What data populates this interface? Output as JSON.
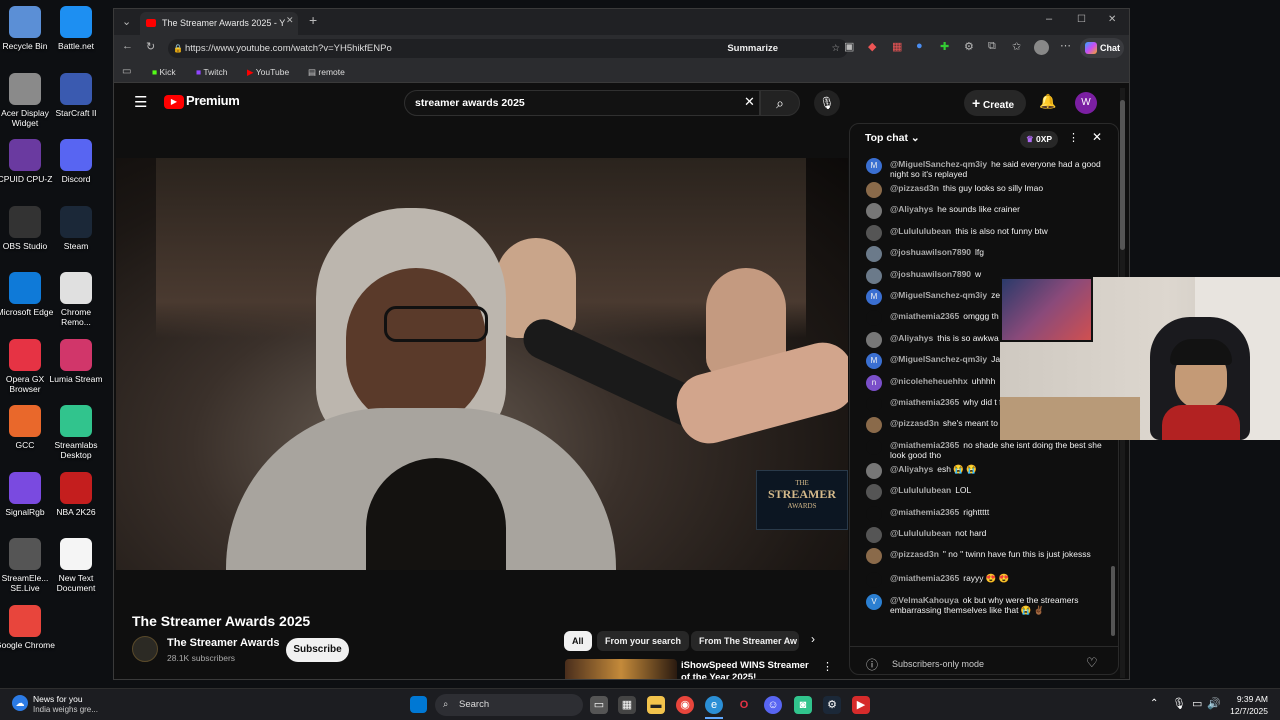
{
  "desktop": {
    "icons": [
      {
        "label": "Recycle Bin",
        "icon": "recycle-bin-icon"
      },
      {
        "label": "Battle.net",
        "icon": "battlenet-icon"
      },
      {
        "label": "Acer Display Widget",
        "icon": "display-widget-icon"
      },
      {
        "label": "StarCraft II",
        "icon": "starcraft-icon"
      },
      {
        "label": "CPUID CPU-Z",
        "icon": "cpuz-icon"
      },
      {
        "label": "Discord",
        "icon": "discord-icon"
      },
      {
        "label": "OBS Studio",
        "icon": "obs-icon"
      },
      {
        "label": "Steam",
        "icon": "steam-icon"
      },
      {
        "label": "Microsoft Edge",
        "icon": "edge-icon"
      },
      {
        "label": "Chrome Remo...",
        "icon": "chrome-remote-icon"
      },
      {
        "label": "Opera GX Browser",
        "icon": "opera-icon"
      },
      {
        "label": "Lumia Stream",
        "icon": "lumia-icon"
      },
      {
        "label": "GCC",
        "icon": "gcc-icon"
      },
      {
        "label": "Streamlabs Desktop",
        "icon": "streamlabs-icon"
      },
      {
        "label": "SignalRgb",
        "icon": "signalrgb-icon"
      },
      {
        "label": "NBA 2K26",
        "icon": "nba-icon"
      },
      {
        "label": "StreamEle... SE.Live",
        "icon": "streamelements-icon"
      },
      {
        "label": "New Text Document",
        "icon": "text-document-icon"
      },
      {
        "label": "Google Chrome",
        "icon": "chrome-icon"
      }
    ]
  },
  "browser": {
    "tab_title": "The Streamer Awards 2025 - Y",
    "url": "https://www.youtube.com/watch?v=YH5hikfENPo",
    "summarize": "Summarize",
    "chat_label": "Chat",
    "favorites": [
      "Kick",
      "Twitch",
      "YouTube",
      "remote"
    ]
  },
  "youtube": {
    "brand": "Premium",
    "search_value": "streamer awards 2025",
    "create": "Create",
    "avatar": "W",
    "video_title": "The Streamer Awards 2025",
    "channel": "The Streamer Awards",
    "subscribers": "28.1K subscribers",
    "subscribe": "Subscribe",
    "overlay_line1": "THE",
    "overlay_line2": "STREAMER",
    "overlay_line3": "AWARDS",
    "chips": [
      "All",
      "From your search",
      "From The Streamer Aw"
    ],
    "rec_title": "iShowSpeed WINS Streamer of the Year 2025!"
  },
  "chat": {
    "header": "Top chat",
    "points": "0XP",
    "footer": "Subscribers-only mode",
    "messages": [
      {
        "user": "@MiguelSanchez-qm3iy",
        "text": "he said everyone had a good night so it's replayed",
        "av": "M",
        "color": "#3a6fd1"
      },
      {
        "user": "@pizzasd3n",
        "text": "this guy looks so silly lmao",
        "av": "",
        "color": "#8a6a4a"
      },
      {
        "user": "@Aliyahys",
        "text": "he sounds like crainer",
        "av": "",
        "color": "#777"
      },
      {
        "user": "@Lulululubean",
        "text": "this is also not funny btw",
        "av": "",
        "color": "#555"
      },
      {
        "user": "@joshuawilson7890",
        "text": "lfg",
        "av": "",
        "color": "#6b7a8a"
      },
      {
        "user": "@joshuawilson7890",
        "text": "w",
        "av": "",
        "color": "#6b7a8a"
      },
      {
        "user": "@MiguelSanchez-qm3iy",
        "text": "ze",
        "av": "M",
        "color": "#3a6fd1"
      },
      {
        "user": "@miathemia2365",
        "text": "omggg th cringeeeee",
        "av": "",
        "color": "#0f0f0f"
      },
      {
        "user": "@Aliyahys",
        "text": "this is so awkwa",
        "av": "",
        "color": "#777"
      },
      {
        "user": "@MiguelSanchez-qm3iy",
        "text": "Ja",
        "av": "M",
        "color": "#3a6fd1"
      },
      {
        "user": "@nicoleheheuehhx",
        "text": "uhhhh",
        "av": "n",
        "color": "#7a4fc9"
      },
      {
        "user": "@miathemia2365",
        "text": "why did t for this likeeeee",
        "av": "",
        "color": "#0f0f0f"
      },
      {
        "user": "@pizzasd3n",
        "text": "she's meant to gggguysssssssss",
        "av": "",
        "color": "#8a6a4a"
      },
      {
        "user": "@miathemia2365",
        "text": "no shade she isnt doing the best she look good tho",
        "av": "",
        "color": "#0f0f0f"
      },
      {
        "user": "@Aliyahys",
        "text": "esh 😭 😭",
        "av": "",
        "color": "#777"
      },
      {
        "user": "@Lulululubean",
        "text": "LOL",
        "av": "",
        "color": "#555"
      },
      {
        "user": "@miathemia2365",
        "text": "righttttt",
        "av": "",
        "color": "#0f0f0f"
      },
      {
        "user": "@Lulululubean",
        "text": "not hard",
        "av": "",
        "color": "#555"
      },
      {
        "user": "@pizzasd3n",
        "text": "\" no \" twinn have fun this is just jokesss",
        "av": "",
        "color": "#8a6a4a"
      },
      {
        "user": "@miathemia2365",
        "text": "rayyy 😍 😍",
        "av": "",
        "color": "#0f0f0f"
      },
      {
        "user": "@VelmaKahouya",
        "text": "ok but why were the streamers embarrassing themselves like that 😭 ✌🏾",
        "av": "V",
        "color": "#2b7fd1"
      }
    ]
  },
  "taskbar": {
    "news_title": "News for you",
    "news_sub": "India weighs gre...",
    "search": "Search",
    "time": "9:39 AM",
    "date": "12/7/2025"
  }
}
